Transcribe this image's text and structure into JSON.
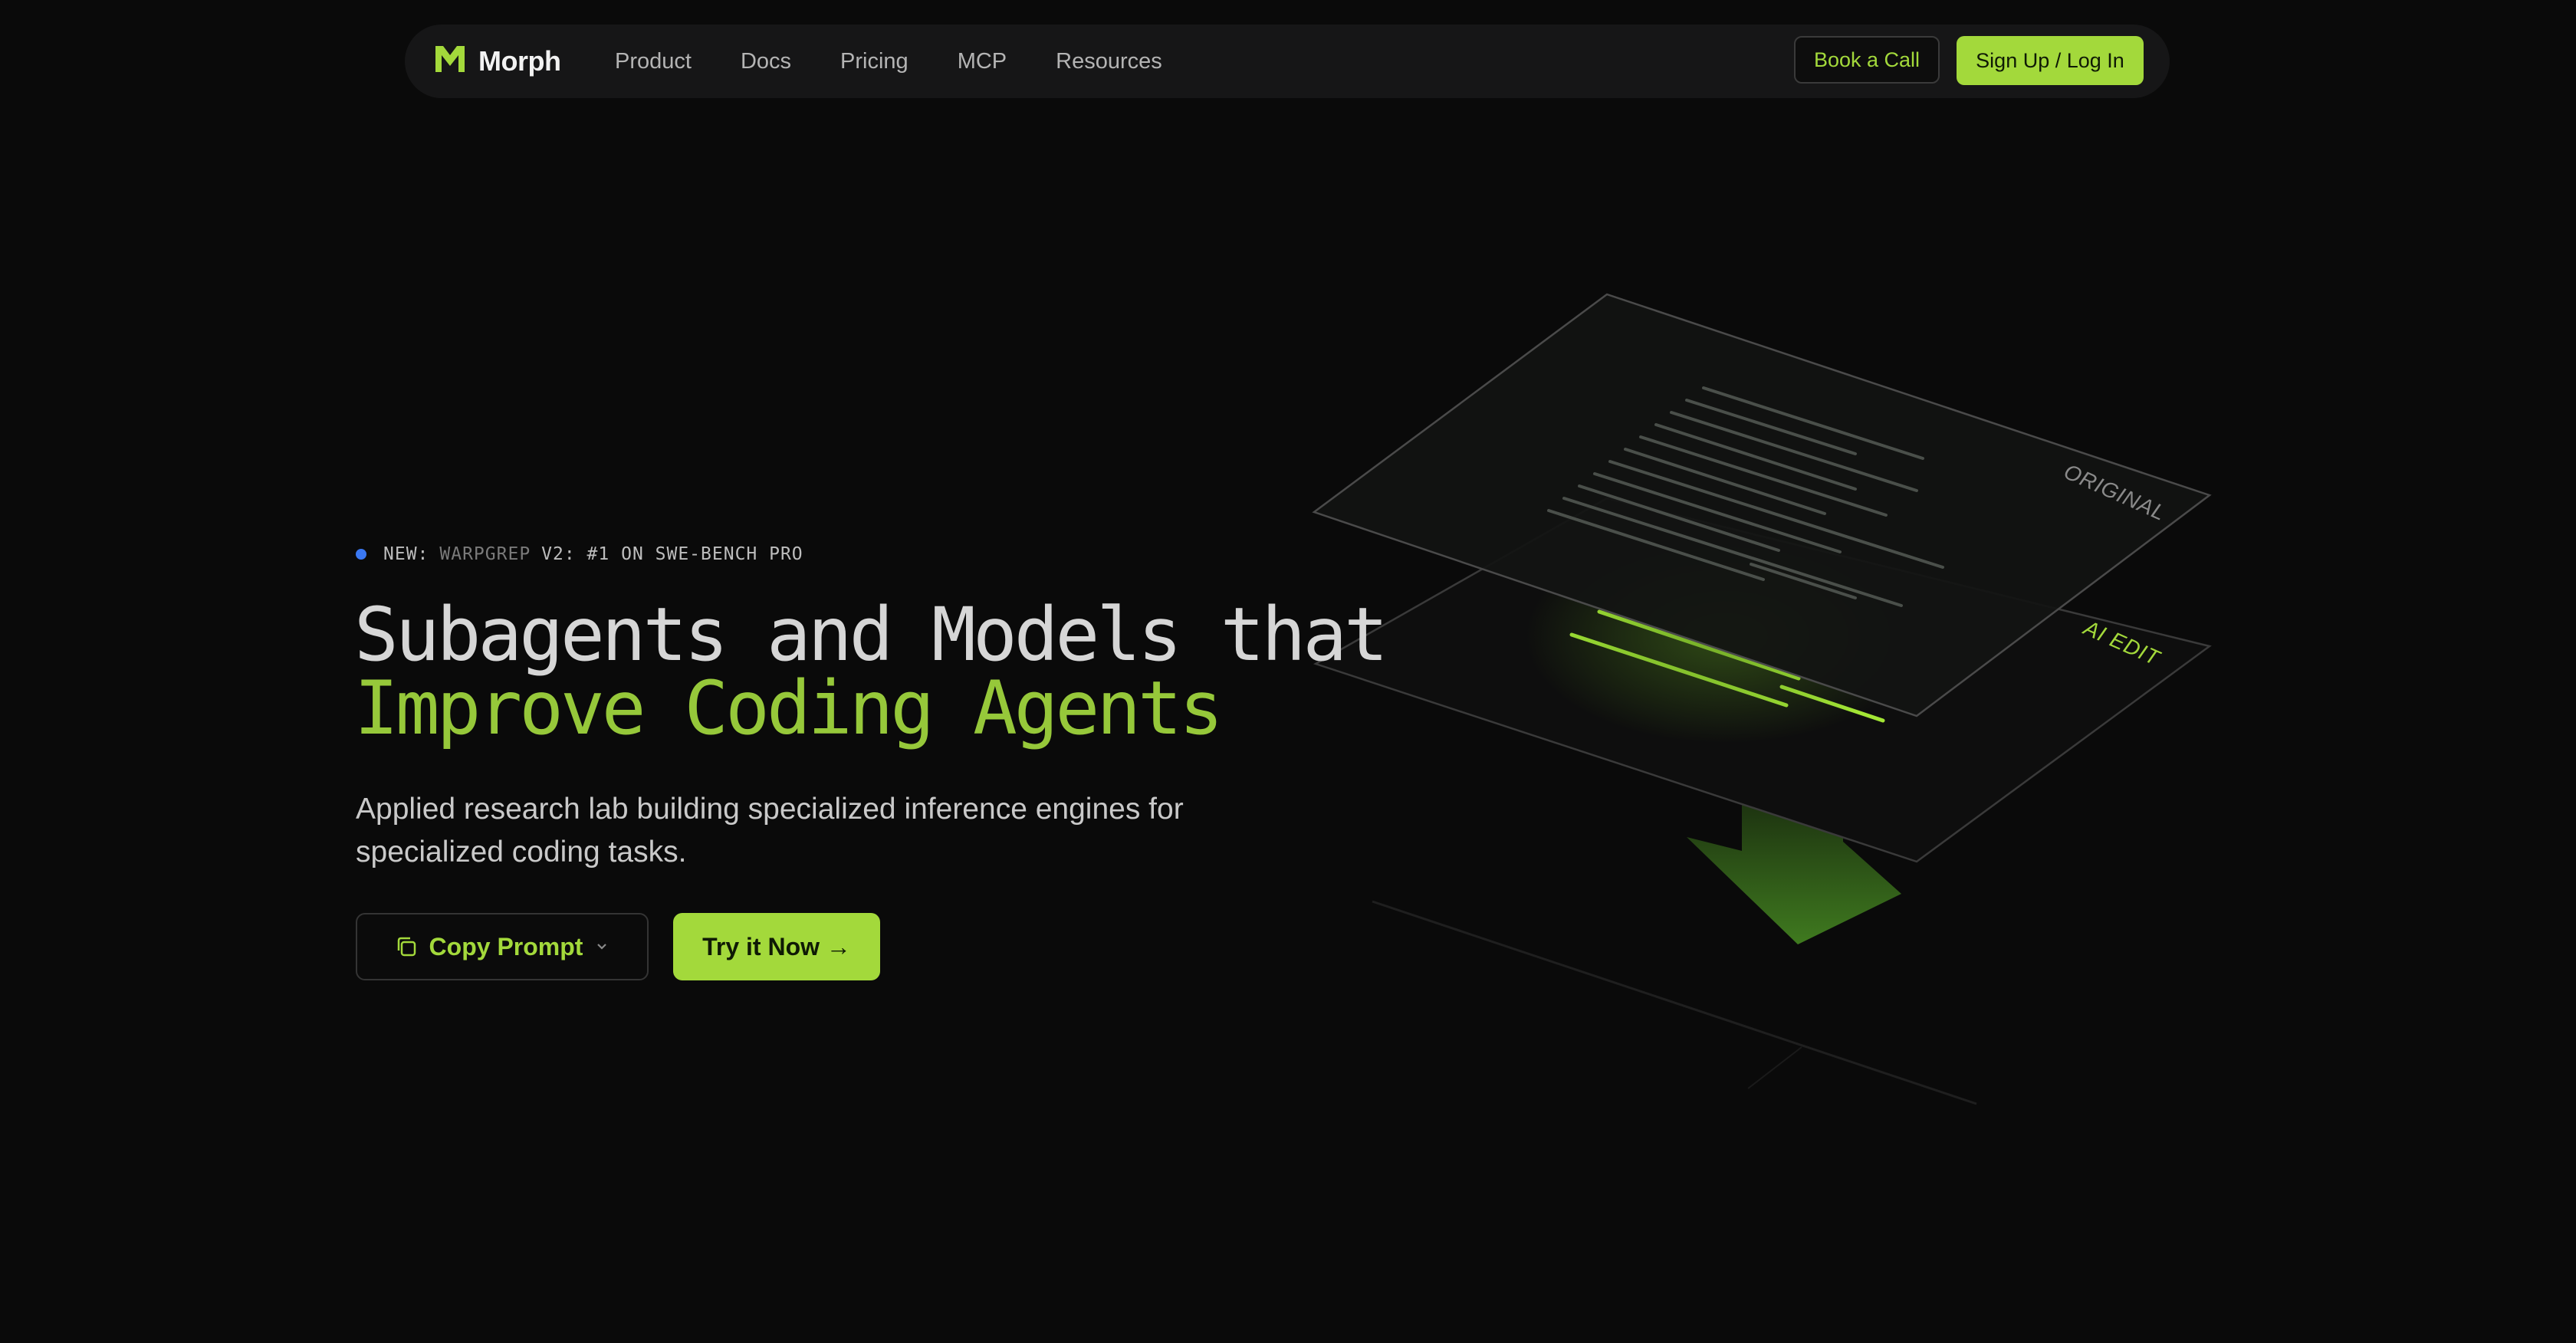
{
  "nav": {
    "brand": "Morph",
    "links": [
      "Product",
      "Docs",
      "Pricing",
      "MCP",
      "Resources"
    ],
    "book_label": "Book a Call",
    "signup_label": "Sign Up / Log In"
  },
  "hero": {
    "badge": {
      "prefix": "NEW:",
      "product": "WARPGREP",
      "suffix": "V2: #1 ON SWE-BENCH PRO"
    },
    "headline_line1": "Subagents and Models that",
    "headline_line2": "Improve Coding Agents",
    "subtitle": "Applied research lab building specialized inference engines for specialized coding tasks.",
    "copy_button_label": "Copy Prompt",
    "try_button_label": "Try it Now →"
  },
  "illustration": {
    "top_plate_label": "ORIGINAL",
    "bottom_plate_label": "AI EDIT"
  },
  "colors": {
    "background": "#0a0a0a",
    "accent": "#a3d93b",
    "headline_green": "#96c83a",
    "badge_dot": "#3a78f2"
  }
}
